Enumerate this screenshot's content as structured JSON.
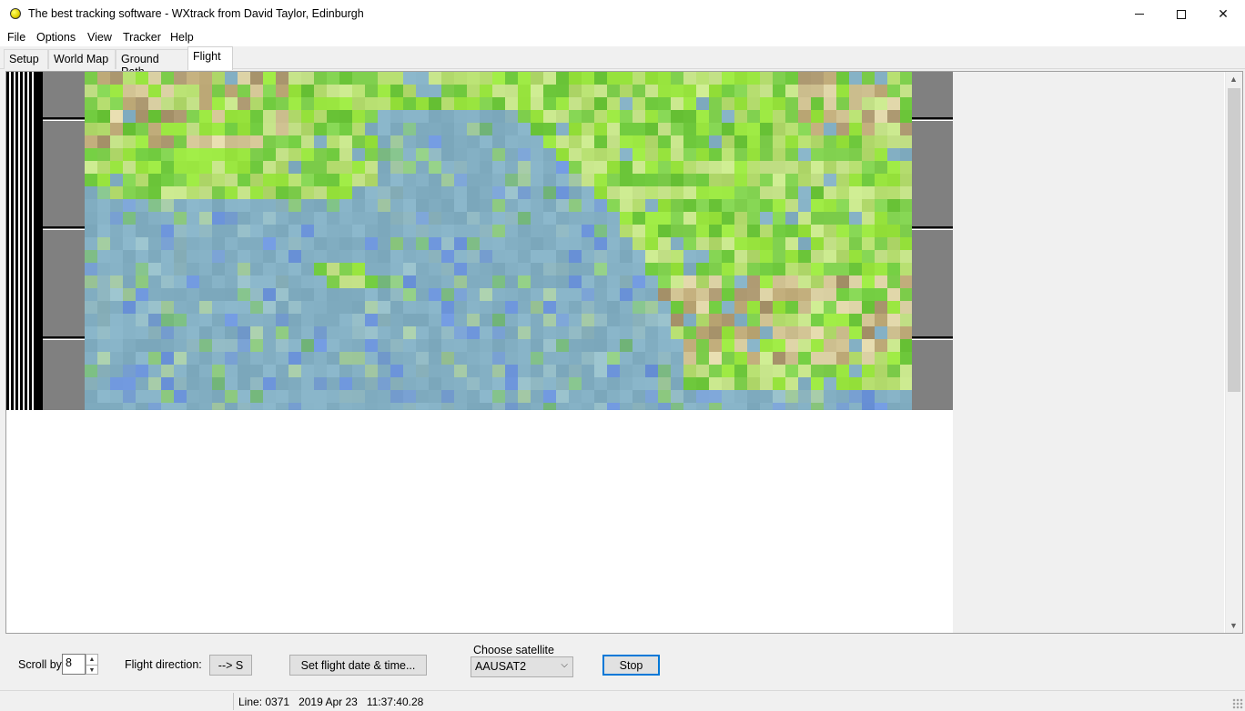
{
  "window": {
    "title": "The best tracking software - WXtrack from David Taylor, Edinburgh",
    "icon": "yellow-ball-icon",
    "controls": {
      "minimize": "─",
      "maximize": "□",
      "close": "✕"
    }
  },
  "menu": [
    "File",
    "Options",
    "View",
    "Tracker",
    "Help"
  ],
  "tabs": [
    {
      "label": "Setup",
      "active": false
    },
    {
      "label": "World Map",
      "active": false
    },
    {
      "label": "Ground Path",
      "active": false
    },
    {
      "label": "Flight",
      "active": true
    }
  ],
  "colors": {
    "water": "#84b0c4",
    "vegetation": "#9ae640",
    "dry_land": "#d2c494",
    "selected_tab_bg": "#ffffff",
    "default_button_border": "#0078d7"
  },
  "controls": {
    "scroll_by_label": "Scroll by",
    "scroll_by_value": "8",
    "flight_direction_label": "Flight direction:",
    "flight_direction_button": "--> S",
    "set_flight_button": "Set flight date & time...",
    "choose_satellite_label": "Choose satellite",
    "satellite_selected": "AAUSAT2",
    "stop_button": "Stop"
  },
  "status": {
    "line_label": "Line: 0371",
    "date": "2019 Apr 23",
    "time": "11:37:40.28"
  }
}
